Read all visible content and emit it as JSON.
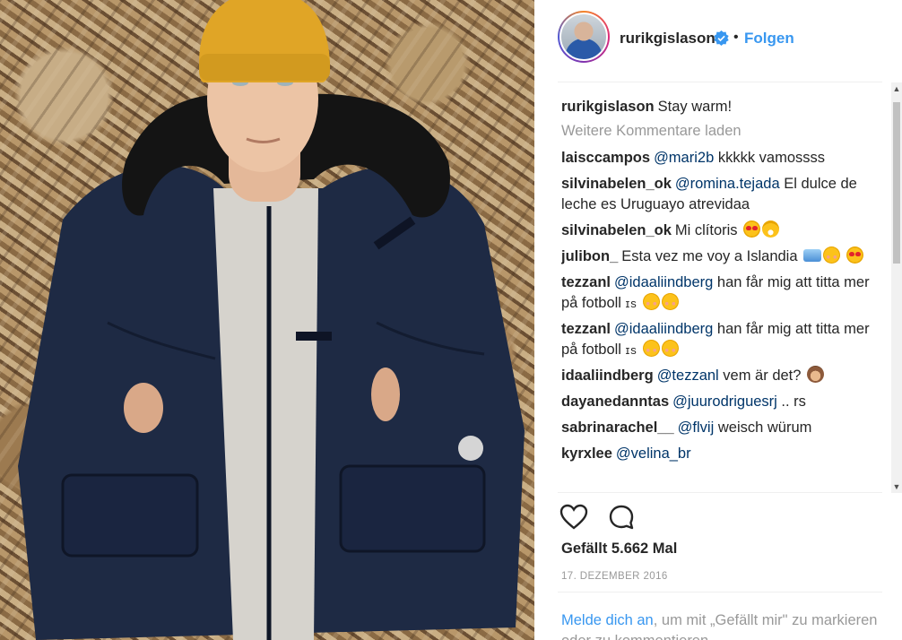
{
  "post": {
    "username": "rurikgislason",
    "follow_label": "Folgen",
    "separator": "•",
    "caption": "Stay warm!"
  },
  "comments": {
    "load_more_label": "Weitere Kommentare laden",
    "items": [
      {
        "user": "laisccampos",
        "mention": "@mari2b",
        "text": " kkkkk vamossss"
      },
      {
        "user": "silvinabelen_ok",
        "mention": "@romina.tejada",
        "text": " El dulce de leche es Uruguayo atrevidaa"
      },
      {
        "user": "silvinabelen_ok",
        "mention": "",
        "text": "Mi clítoris"
      },
      {
        "user": "julibon_",
        "mention": "",
        "text": "Esta vez me voy a Islandia"
      },
      {
        "user": "tezzanl",
        "mention": "@idaaliindberg",
        "text": " han får mig att titta mer på fotboll",
        "suffix": "ɪs"
      },
      {
        "user": "tezzanl",
        "mention": "@idaaliindberg",
        "text": " han får mig att titta mer på fotboll",
        "suffix": "ɪs"
      },
      {
        "user": "idaaliindberg",
        "mention": "@tezzanl",
        "text": " vem är det?"
      },
      {
        "user": "dayanedanntas",
        "mention": "@juurodriguesrj",
        "text": " .. rs"
      },
      {
        "user": "sabrinarachel__",
        "mention": "@flvij",
        "text": " weisch würum"
      },
      {
        "user": "kyrxlee",
        "mention": "@velina_br",
        "text": ""
      }
    ]
  },
  "footer": {
    "likes": "Gefällt 5.662 Mal",
    "date": "17. Dezember 2016",
    "login_link": "Melde dich an",
    "login_text": ", um mit „Gefällt mir\" zu markieren oder zu kommentieren."
  },
  "icons": {
    "like": "heart-outline-icon",
    "comment": "speech-bubble-icon",
    "verified": "verified-badge-icon"
  },
  "colors": {
    "link_blue": "#3897f0",
    "mention_blue": "#003569",
    "text": "#262626",
    "muted": "#999999",
    "beanie_yellow": "#e0a526",
    "jacket_navy": "#1e2a44"
  }
}
